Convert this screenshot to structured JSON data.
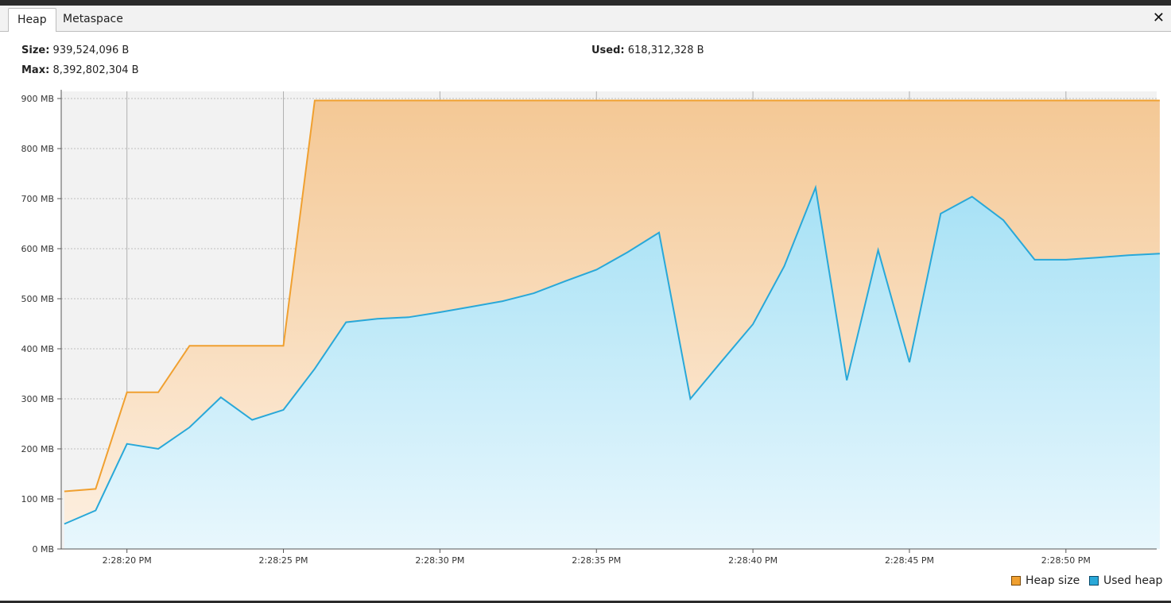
{
  "tabs": [
    {
      "label": "Heap"
    },
    {
      "label": "Metaspace"
    }
  ],
  "close_label": "✕",
  "stats": {
    "size_label": "Size:",
    "size_value": "939,524,096 B",
    "used_label": "Used:",
    "used_value": "618,312,328 B",
    "max_label": "Max:",
    "max_value": "8,392,802,304 B"
  },
  "colors": {
    "heap_line": "#f0a030",
    "used_line": "#29a8d8"
  },
  "chart_data": {
    "type": "area",
    "x": [
      -1,
      0,
      1,
      2,
      3,
      4,
      5,
      6,
      7,
      8,
      9,
      10,
      11,
      12,
      13,
      14,
      15,
      16,
      17,
      18,
      19,
      20,
      21,
      22,
      23,
      24,
      25,
      26,
      27,
      28,
      29,
      30,
      31,
      32,
      33,
      34
    ],
    "x_ticks": [
      {
        "x": 1,
        "label": "2:28:20 PM"
      },
      {
        "x": 6,
        "label": "2:28:25 PM"
      },
      {
        "x": 11,
        "label": "2:28:30 PM"
      },
      {
        "x": 16,
        "label": "2:28:35 PM"
      },
      {
        "x": 21,
        "label": "2:28:40 PM"
      },
      {
        "x": 26,
        "label": "2:28:45 PM"
      },
      {
        "x": 31,
        "label": "2:28:50 PM"
      }
    ],
    "y_ticks": [
      {
        "v": 0,
        "label": "0 MB"
      },
      {
        "v": 100,
        "label": "100 MB"
      },
      {
        "v": 200,
        "label": "200 MB"
      },
      {
        "v": 300,
        "label": "300 MB"
      },
      {
        "v": 400,
        "label": "400 MB"
      },
      {
        "v": 500,
        "label": "500 MB"
      },
      {
        "v": 600,
        "label": "600 MB"
      },
      {
        "v": 700,
        "label": "700 MB"
      },
      {
        "v": 800,
        "label": "800 MB"
      },
      {
        "v": 900,
        "label": "900 MB"
      }
    ],
    "ylim": [
      0,
      900
    ],
    "xlim": [
      -1.1,
      33.9
    ],
    "series": [
      {
        "name": "Heap size",
        "values": [
          115,
          120,
          313,
          313,
          406,
          406,
          406,
          406,
          896,
          896,
          896,
          896,
          896,
          896,
          896,
          896,
          896,
          896,
          896,
          896,
          896,
          896,
          896,
          896,
          896,
          896,
          896,
          896,
          896,
          896,
          896,
          896,
          896,
          896,
          896,
          896
        ]
      },
      {
        "name": "Used heap",
        "values": [
          50,
          77,
          210,
          200,
          243,
          303,
          258,
          278,
          360,
          453,
          460,
          463,
          473,
          484,
          495,
          511,
          535,
          558,
          593,
          632,
          300,
          375,
          449,
          565,
          722,
          337,
          597,
          373,
          670,
          704,
          657,
          578,
          578,
          582,
          587,
          590
        ]
      }
    ],
    "legend_position": "bottom-right",
    "grid": true
  }
}
